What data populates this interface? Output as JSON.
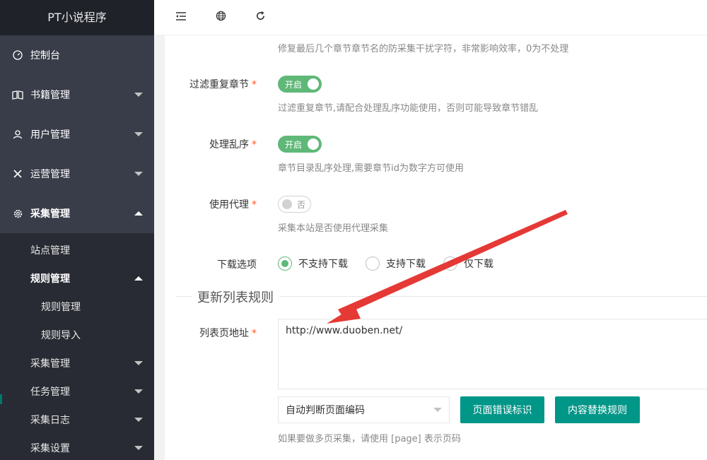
{
  "app": {
    "title": "PT小说程序"
  },
  "sidebar": {
    "items": [
      {
        "label": "控制台",
        "icon": "dashboard-icon"
      },
      {
        "label": "书籍管理",
        "icon": "book-icon"
      },
      {
        "label": "用户管理",
        "icon": "user-icon"
      },
      {
        "label": "运营管理",
        "icon": "tools-icon"
      },
      {
        "label": "采集管理",
        "icon": "gear-icon"
      }
    ],
    "sub": {
      "site": "站点管理",
      "rules": "规则管理",
      "rules_children": {
        "manage": "规则管理",
        "import": "规则导入"
      },
      "collect": "采集管理",
      "tasks": "任务管理",
      "logs": "采集日志",
      "settings": "采集设置"
    }
  },
  "header": {
    "icons": [
      "menu-fold-icon",
      "globe-icon",
      "refresh-icon"
    ]
  },
  "form": {
    "top_hint": "修复最后几个章节章节名的防采集干扰字符，非常影响效率，0为不处理",
    "filter_dup": {
      "label": "过滤重复章节",
      "switch_text": "开启",
      "hint": "过滤重复章节,请配合处理乱序功能使用，否则可能导致章节错乱"
    },
    "disorder": {
      "label": "处理乱序",
      "switch_text": "开启",
      "hint": "章节目录乱序处理,需要章节id为数字方可使用"
    },
    "proxy": {
      "label": "使用代理",
      "switch_text": "否",
      "hint": "采集本站是否使用代理采集"
    },
    "download": {
      "label": "下载选项",
      "options": [
        "不支持下载",
        "支持下载",
        "仅下载"
      ],
      "selected": "不支持下载"
    },
    "section_title": "更新列表规则",
    "list_url": {
      "label": "列表页地址",
      "value": "http://www.duoben.net/"
    },
    "encoding_select": "自动判断页面编码",
    "btn_error_mark": "页面错误标识",
    "btn_replace": "内容替换规则",
    "page_hint": "如果要做多页采集，请使用 [page] 表示页码"
  },
  "colors": {
    "accent": "#009688",
    "switch_on": "#5fb878",
    "sidebar": "#393d49",
    "arrow": "#e53935"
  }
}
